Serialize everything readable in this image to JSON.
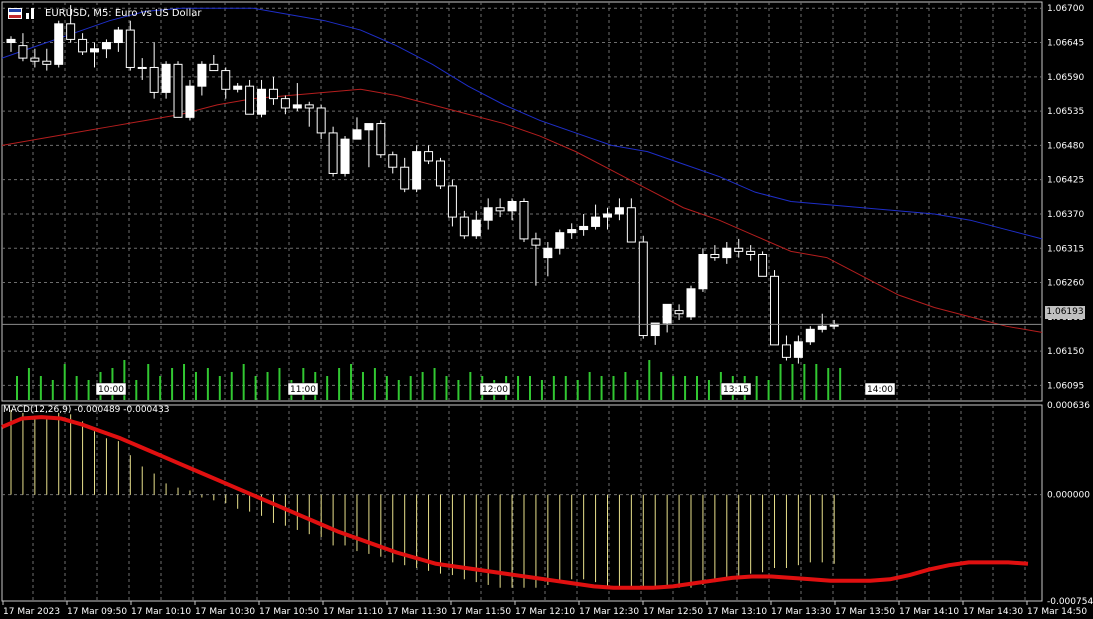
{
  "header": {
    "symbol": "EURUSD",
    "timeframe": "M5",
    "description": "Euro vs US Dollar",
    "title": "EURUSD, M5:  Euro vs US Dollar"
  },
  "colors": {
    "background": "#000000",
    "grid": "#6e6e6e",
    "bull_candle": "#ffffff",
    "bear_candle": "#000000",
    "wick": "#ffffff",
    "ma_fast": "#b41e1e",
    "ma_slow": "#1e2ec8",
    "volume": "#32c832",
    "macd_hist": "#e8e08c",
    "macd_signal": "#e01010",
    "price_line": "#8c8c8c"
  },
  "current_price": "1.06193",
  "chart_data": [
    {
      "type": "candlestick",
      "panel": "price",
      "title": "EURUSD, M5:  Euro vs US Dollar",
      "ylim": [
        1.0607,
        1.0671
      ],
      "y_ticks": [
        "1.06700",
        "1.06645",
        "1.06590",
        "1.06535",
        "1.06480",
        "1.06425",
        "1.06370",
        "1.06315",
        "1.06260",
        "1.06205",
        "1.06150",
        "1.06095"
      ],
      "time_markers": [
        "10:00",
        "11:00",
        "12:00",
        "13:15",
        "14:00"
      ],
      "x_labels": [
        "17 Mar 2023",
        "17 Mar 09:50",
        "17 Mar 10:10",
        "17 Mar 10:30",
        "17 Mar 10:50",
        "17 Mar 11:10",
        "17 Mar 11:30",
        "17 Mar 11:50",
        "17 Mar 12:10",
        "17 Mar 12:30",
        "17 Mar 12:50",
        "17 Mar 13:10",
        "17 Mar 13:30",
        "17 Mar 13:50",
        "17 Mar 14:10",
        "17 Mar 14:30",
        "17 Mar 14:50"
      ],
      "ohlc": [
        [
          1.06645,
          1.06655,
          1.0663,
          1.0665
        ],
        [
          1.0664,
          1.0666,
          1.06615,
          1.0662
        ],
        [
          1.0662,
          1.06635,
          1.06605,
          1.06615
        ],
        [
          1.06615,
          1.06635,
          1.066,
          1.0661
        ],
        [
          1.0661,
          1.0668,
          1.06605,
          1.06675
        ],
        [
          1.06675,
          1.06705,
          1.06645,
          1.0665
        ],
        [
          1.0665,
          1.0666,
          1.06625,
          1.0663
        ],
        [
          1.0663,
          1.06645,
          1.06605,
          1.06635
        ],
        [
          1.06635,
          1.0665,
          1.0662,
          1.06645
        ],
        [
          1.06645,
          1.0667,
          1.0663,
          1.06665
        ],
        [
          1.06665,
          1.0668,
          1.066,
          1.06605
        ],
        [
          1.06605,
          1.0662,
          1.06585,
          1.06605
        ],
        [
          1.06605,
          1.06645,
          1.06555,
          1.06565
        ],
        [
          1.06565,
          1.06615,
          1.06555,
          1.0661
        ],
        [
          1.0661,
          1.06615,
          1.06525,
          1.06525
        ],
        [
          1.06525,
          1.06585,
          1.0652,
          1.06575
        ],
        [
          1.06575,
          1.06615,
          1.0656,
          1.0661
        ],
        [
          1.0661,
          1.06625,
          1.066,
          1.066
        ],
        [
          1.066,
          1.06605,
          1.06555,
          1.0657
        ],
        [
          1.0657,
          1.0658,
          1.06565,
          1.06575
        ],
        [
          1.06575,
          1.06585,
          1.0653,
          1.0653
        ],
        [
          1.0653,
          1.06585,
          1.06525,
          1.0657
        ],
        [
          1.0657,
          1.0659,
          1.06545,
          1.06555
        ],
        [
          1.06555,
          1.0656,
          1.0653,
          1.0654
        ],
        [
          1.0654,
          1.0658,
          1.06535,
          1.06545
        ],
        [
          1.06545,
          1.0655,
          1.0651,
          1.0654
        ],
        [
          1.0654,
          1.06545,
          1.0649,
          1.065
        ],
        [
          1.065,
          1.0651,
          1.0643,
          1.06435
        ],
        [
          1.06435,
          1.06495,
          1.0643,
          1.0649
        ],
        [
          1.0649,
          1.06525,
          1.0649,
          1.06505
        ],
        [
          1.06505,
          1.06515,
          1.06445,
          1.06515
        ],
        [
          1.06515,
          1.0652,
          1.0646,
          1.06465
        ],
        [
          1.06465,
          1.0647,
          1.06435,
          1.06445
        ],
        [
          1.06445,
          1.0646,
          1.06405,
          1.0641
        ],
        [
          1.0641,
          1.0648,
          1.06405,
          1.0647
        ],
        [
          1.0647,
          1.0648,
          1.0645,
          1.06455
        ],
        [
          1.06455,
          1.0646,
          1.0641,
          1.06415
        ],
        [
          1.06415,
          1.06425,
          1.0635,
          1.06365
        ],
        [
          1.06365,
          1.06375,
          1.0633,
          1.06335
        ],
        [
          1.06335,
          1.06375,
          1.0633,
          1.0636
        ],
        [
          1.0636,
          1.06395,
          1.06345,
          1.0638
        ],
        [
          1.0638,
          1.06395,
          1.06365,
          1.06375
        ],
        [
          1.06375,
          1.06395,
          1.0636,
          1.0639
        ],
        [
          1.0639,
          1.06395,
          1.06325,
          1.0633
        ],
        [
          1.0633,
          1.0634,
          1.06255,
          1.0632
        ],
        [
          1.063,
          1.06325,
          1.0627,
          1.06315
        ],
        [
          1.06315,
          1.06345,
          1.06305,
          1.0634
        ],
        [
          1.0634,
          1.06355,
          1.0633,
          1.06345
        ],
        [
          1.06345,
          1.0637,
          1.06335,
          1.0635
        ],
        [
          1.0635,
          1.06385,
          1.06345,
          1.06365
        ],
        [
          1.06365,
          1.0638,
          1.06345,
          1.0637
        ],
        [
          1.0637,
          1.06395,
          1.0636,
          1.0638
        ],
        [
          1.0638,
          1.06395,
          1.06325,
          1.06325
        ],
        [
          1.06325,
          1.06335,
          1.0617,
          1.06175
        ],
        [
          1.06175,
          1.06195,
          1.0616,
          1.06195
        ],
        [
          1.06195,
          1.06225,
          1.0618,
          1.06225
        ],
        [
          1.06215,
          1.06225,
          1.062,
          1.0621
        ],
        [
          1.06205,
          1.06255,
          1.062,
          1.0625
        ],
        [
          1.0625,
          1.06315,
          1.06245,
          1.06305
        ],
        [
          1.06305,
          1.0632,
          1.06295,
          1.063
        ],
        [
          1.063,
          1.06325,
          1.0629,
          1.06315
        ],
        [
          1.06315,
          1.0633,
          1.063,
          1.0631
        ],
        [
          1.0631,
          1.0632,
          1.06295,
          1.06305
        ],
        [
          1.06305,
          1.0631,
          1.0627,
          1.0627
        ],
        [
          1.0627,
          1.0628,
          1.0616,
          1.0616
        ],
        [
          1.0616,
          1.06175,
          1.06135,
          1.0614
        ],
        [
          1.0614,
          1.06175,
          1.0613,
          1.06165
        ],
        [
          1.06165,
          1.0619,
          1.0616,
          1.06185
        ],
        [
          1.06185,
          1.0621,
          1.0618,
          1.0619
        ],
        [
          1.0619,
          1.062,
          1.06185,
          1.06193
        ]
      ],
      "ma_fast": [
        1.0648,
        1.0649,
        1.065,
        1.0651,
        1.0652,
        1.0653,
        1.06545,
        1.06555,
        1.0656,
        1.06565,
        1.0657,
        1.0656,
        1.06545,
        1.0653,
        1.06515,
        1.06495,
        1.0647,
        1.0644,
        1.0641,
        1.0638,
        1.0636,
        1.06335,
        1.0631,
        1.063,
        1.0627,
        1.0624,
        1.0622,
        1.06205,
        1.0619,
        1.0618
      ],
      "ma_slow": [
        1.0662,
        1.0664,
        1.0666,
        1.0668,
        1.06695,
        1.067,
        1.067,
        1.067,
        1.0669,
        1.0668,
        1.06665,
        1.0664,
        1.0661,
        1.06575,
        1.06545,
        1.0652,
        1.065,
        1.0648,
        1.0647,
        1.0645,
        1.0643,
        1.06405,
        1.0639,
        1.06385,
        1.0638,
        1.06375,
        1.0637,
        1.0636,
        1.06345,
        1.0633
      ],
      "volume": [
        0.6,
        0.8,
        0.6,
        0.5,
        0.9,
        0.6,
        0.5,
        0.7,
        0.8,
        1.0,
        0.5,
        0.9,
        0.6,
        0.8,
        0.9,
        0.7,
        0.8,
        0.6,
        0.7,
        0.9,
        0.6,
        0.7,
        0.8,
        0.5,
        0.8,
        0.7,
        0.6,
        0.8,
        0.9,
        0.7,
        0.8,
        0.6,
        0.5,
        0.6,
        0.7,
        0.8,
        0.6,
        0.5,
        0.7,
        0.6,
        0.5,
        0.6,
        0.6,
        0.6,
        0.5,
        0.6,
        0.6,
        0.5,
        0.7,
        0.6,
        0.6,
        0.7,
        0.5,
        1.0,
        0.7,
        0.6,
        0.6,
        0.6,
        0.5,
        0.7,
        0.6,
        0.6,
        0.6,
        0.5,
        0.9,
        0.9,
        0.9,
        0.9,
        0.8,
        0.8
      ]
    },
    {
      "type": "macd",
      "panel": "indicator",
      "label": "MACD(12,26,9) -0.000489 -0.000433",
      "params": [
        12,
        26,
        9
      ],
      "macd_value": "-0.000489",
      "signal_value": "-0.000433",
      "ylim": [
        -0.000754,
        0.000636
      ],
      "y_ticks": [
        "0.000636",
        "0.000000",
        "-0.000754"
      ],
      "histogram": [
        0.0006,
        0.00058,
        0.00056,
        0.00055,
        0.00058,
        0.00057,
        0.00052,
        0.00045,
        0.0004,
        0.00038,
        0.00028,
        0.0002,
        0.00015,
        8e-05,
        5e-05,
        3e-05,
        -2e-05,
        -4e-05,
        -6e-05,
        -0.0001,
        -0.00012,
        -0.00015,
        -0.0002,
        -0.00022,
        -0.00025,
        -0.00028,
        -0.0003,
        -0.00036,
        -0.00036,
        -0.0004,
        -0.00042,
        -0.00044,
        -0.00048,
        -0.0005,
        -0.00052,
        -0.00054,
        -0.00056,
        -0.00057,
        -0.0006,
        -0.00062,
        -0.00064,
        -0.00066,
        -0.00066,
        -0.00066,
        -0.00066,
        -0.00064,
        -0.00062,
        -0.0006,
        -0.0006,
        -0.00062,
        -0.00066,
        -0.00066,
        -0.00066,
        -0.00066,
        -0.00066,
        -0.00066,
        -0.00066,
        -0.00066,
        -0.00064,
        -0.00062,
        -0.0006,
        -0.00058,
        -0.00056,
        -0.00055,
        -0.00052,
        -0.00052,
        -0.0005,
        -0.00048,
        -0.00048,
        -0.00049
      ],
      "signal": [
        0.00048,
        0.00054,
        0.00055,
        0.00054,
        0.0005,
        0.00045,
        0.0004,
        0.00034,
        0.00028,
        0.00022,
        0.00016,
        0.0001,
        4e-05,
        -2e-05,
        -8e-05,
        -0.00014,
        -0.0002,
        -0.00026,
        -0.00031,
        -0.00036,
        -0.00041,
        -0.00045,
        -0.00049,
        -0.00051,
        -0.00053,
        -0.00055,
        -0.00057,
        -0.00059,
        -0.00061,
        -0.00063,
        -0.00065,
        -0.00066,
        -0.00066,
        -0.00066,
        -0.00065,
        -0.00063,
        -0.00061,
        -0.00059,
        -0.00058,
        -0.00058,
        -0.00059,
        -0.0006,
        -0.00061,
        -0.00061,
        -0.00061,
        -0.0006,
        -0.00057,
        -0.00053,
        -0.0005,
        -0.00048,
        -0.00048,
        -0.00048,
        -0.00049
      ]
    }
  ]
}
